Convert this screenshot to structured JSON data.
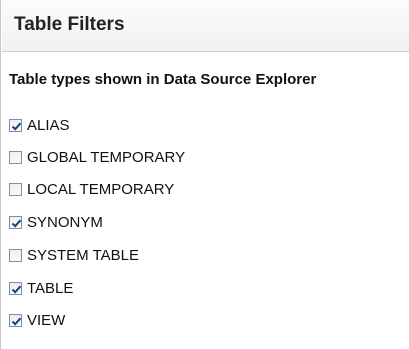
{
  "panel": {
    "title": "Table Filters",
    "section_label": "Table types shown in Data Source Explorer"
  },
  "items": [
    {
      "label": "ALIAS",
      "checked": true
    },
    {
      "label": "GLOBAL TEMPORARY",
      "checked": false
    },
    {
      "label": "LOCAL TEMPORARY",
      "checked": false
    },
    {
      "label": "SYNONYM",
      "checked": true
    },
    {
      "label": "SYSTEM TABLE",
      "checked": false
    },
    {
      "label": "TABLE",
      "checked": true
    },
    {
      "label": "VIEW",
      "checked": true
    }
  ],
  "colors": {
    "checkmark": "#1f3f7a",
    "checkbox_border": "#8f8f8f"
  }
}
